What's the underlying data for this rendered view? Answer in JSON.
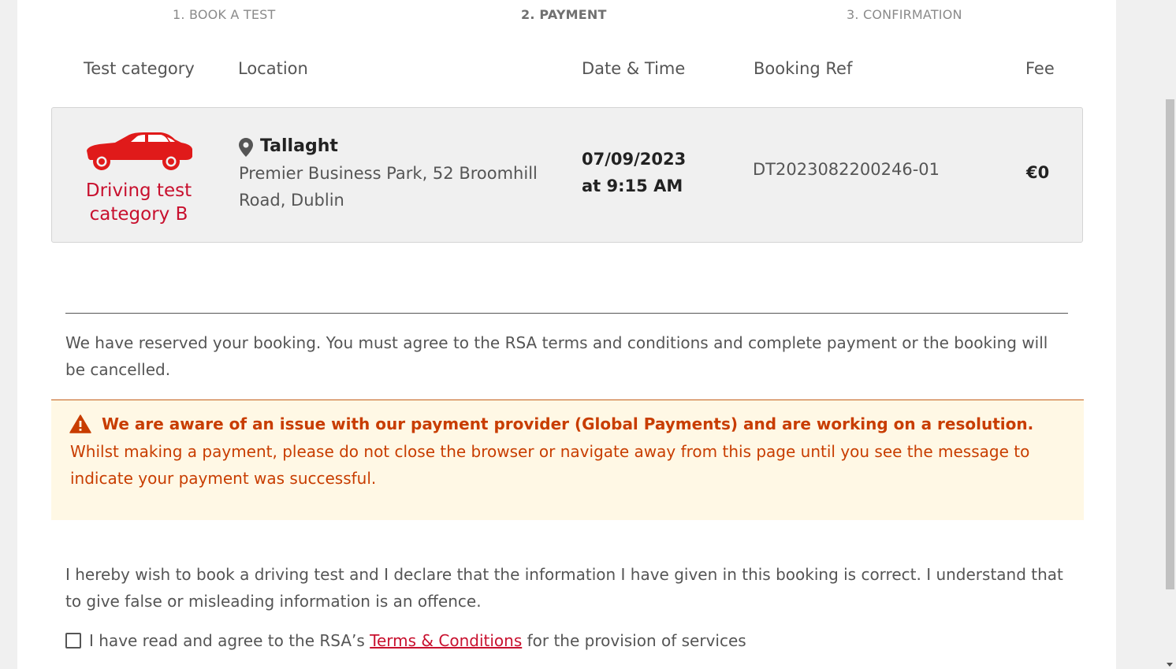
{
  "steps": [
    {
      "label": "1. BOOK A TEST"
    },
    {
      "label": "2. PAYMENT"
    },
    {
      "label": "3. CONFIRMATION"
    }
  ],
  "table_headers": {
    "category": "Test category",
    "location": "Location",
    "datetime": "Date & Time",
    "ref": "Booking Ref",
    "fee": "Fee"
  },
  "booking": {
    "category_line1": "Driving test",
    "category_line2": "category B",
    "location_name": "Tallaght",
    "location_address": "Premier Business Park, 52 Broomhill Road, Dublin",
    "date": "07/09/2023",
    "time": "at 9:15 AM",
    "ref": "DT2023082200246-01",
    "fee": "€0"
  },
  "reserved_notice": "We have reserved your booking. You must agree to the RSA terms and conditions and complete payment or the booking will be cancelled.",
  "warning": {
    "title": "We are aware of an issue with our payment provider (Global Payments) and are working on a resolution.",
    "body": "Whilst making a payment, please do not close the browser or navigate away from this page until you see the message to indicate your payment was successful."
  },
  "declaration": "I hereby wish to book a driving test and I declare that the information I have given in this booking is correct. I understand that to give false or misleading information is an offence.",
  "agree": {
    "prefix": "I have read and agree to the RSA’s ",
    "link": "Terms & Conditions",
    "suffix": " for the provision of services"
  },
  "colors": {
    "brand_red": "#c8102e",
    "warning_text": "#c83d00",
    "warning_bg": "#fff8e5"
  },
  "icons": [
    "car-icon",
    "map-pin-icon",
    "warning-triangle-icon"
  ]
}
